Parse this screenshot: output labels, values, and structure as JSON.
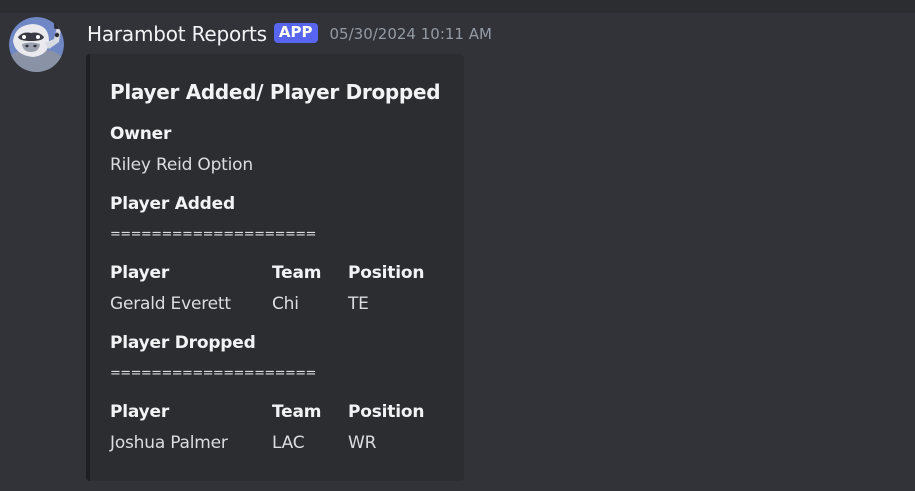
{
  "message": {
    "username": "Harambot Reports",
    "badge": "APP",
    "timestamp": "05/30/2024 10:11 AM"
  },
  "embed": {
    "title": "Player Added/ Player Dropped",
    "owner_label": "Owner",
    "owner_value": "Riley Reid Option",
    "added": {
      "label": "Player Added",
      "divider": "====================",
      "columns": [
        "Player",
        "Team",
        "Position"
      ],
      "row": [
        "Gerald Everett",
        "Chi",
        "TE"
      ]
    },
    "dropped": {
      "label": "Player Dropped",
      "divider": "====================",
      "columns": [
        "Player",
        "Team",
        "Position"
      ],
      "row": [
        "Joshua Palmer",
        "LAC",
        "WR"
      ]
    }
  },
  "colors": {
    "background": "#313338",
    "embed_background": "#2b2d31",
    "badge": "#5865f2",
    "timestamp": "#949ba4"
  },
  "icons": {
    "avatar": "gorilla-robot-avatar"
  }
}
